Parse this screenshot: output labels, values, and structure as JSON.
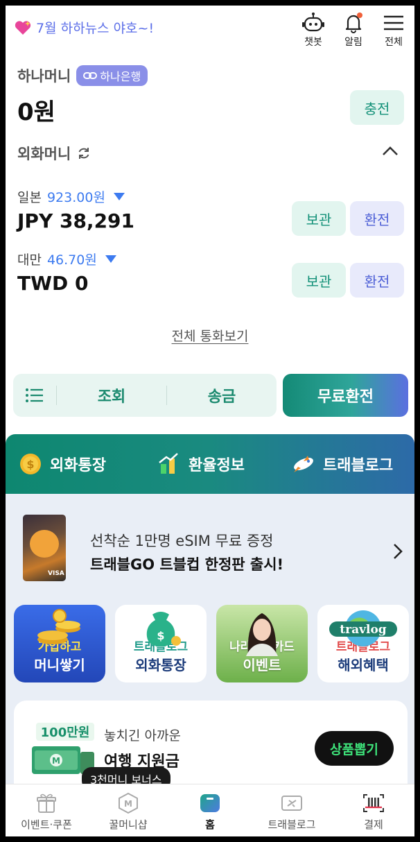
{
  "header": {
    "promo_text": "7월 하하뉴스 야호~!",
    "icons": [
      {
        "label": "챗봇",
        "icon": "robot-icon"
      },
      {
        "label": "알림",
        "icon": "bell-icon"
      },
      {
        "label": "전체",
        "icon": "menu-icon"
      }
    ]
  },
  "hana_money": {
    "title": "하나머니",
    "bank_badge": "하나은행",
    "amount": "0원",
    "charge_label": "충전"
  },
  "fx_money": {
    "title": "외화머니",
    "currencies": [
      {
        "country": "일본",
        "rate": "923.00원",
        "amount": "JPY 38,291",
        "keep_label": "보관",
        "exchange_label": "환전"
      },
      {
        "country": "대만",
        "rate": "46.70원",
        "amount": "TWD 0",
        "keep_label": "보관",
        "exchange_label": "환전"
      }
    ],
    "view_all": "전체 통화보기"
  },
  "actions": {
    "inquiry": "조회",
    "transfer": "송금",
    "free_exchange": "무료환전"
  },
  "band": {
    "items": [
      {
        "label": "외화통장",
        "icon": "coin-icon"
      },
      {
        "label": "환율정보",
        "icon": "chart-icon"
      },
      {
        "label": "트래블로그",
        "icon": "airplane-icon"
      }
    ]
  },
  "promo": {
    "line1": "선착순 1만명 eSIM 무료 증정",
    "line2": "트래블GO 트블컵 한정판 출시!"
  },
  "tiles": [
    {
      "line1": "가입하고",
      "line2": "머니쌓기"
    },
    {
      "line1": "트래블로그",
      "line2": "외화통장"
    },
    {
      "line1": "나라사랑카드",
      "line2": "이벤트"
    },
    {
      "line1": "트래블로그",
      "line2": "해외혜택",
      "logo": "travlog"
    }
  ],
  "gift": {
    "badge": "100만원",
    "line1": "놓치긴 아까운",
    "line2": "여행 지원금",
    "button": "상품뽑기"
  },
  "tooltip": "3천머니 보너스",
  "bottom_nav": [
    {
      "label": "이벤트·쿠폰",
      "icon": "gift-icon"
    },
    {
      "label": "꿀머니샵",
      "icon": "m-hexagon-icon"
    },
    {
      "label": "홈",
      "icon": "home-icon"
    },
    {
      "label": "트래블로그",
      "icon": "plane-ticket-icon"
    },
    {
      "label": "결제",
      "icon": "barcode-scan-icon"
    }
  ],
  "colors": {
    "accent_teal": "#139178",
    "accent_blue": "#5b6ee8",
    "rate_blue": "#3d7bf0"
  }
}
